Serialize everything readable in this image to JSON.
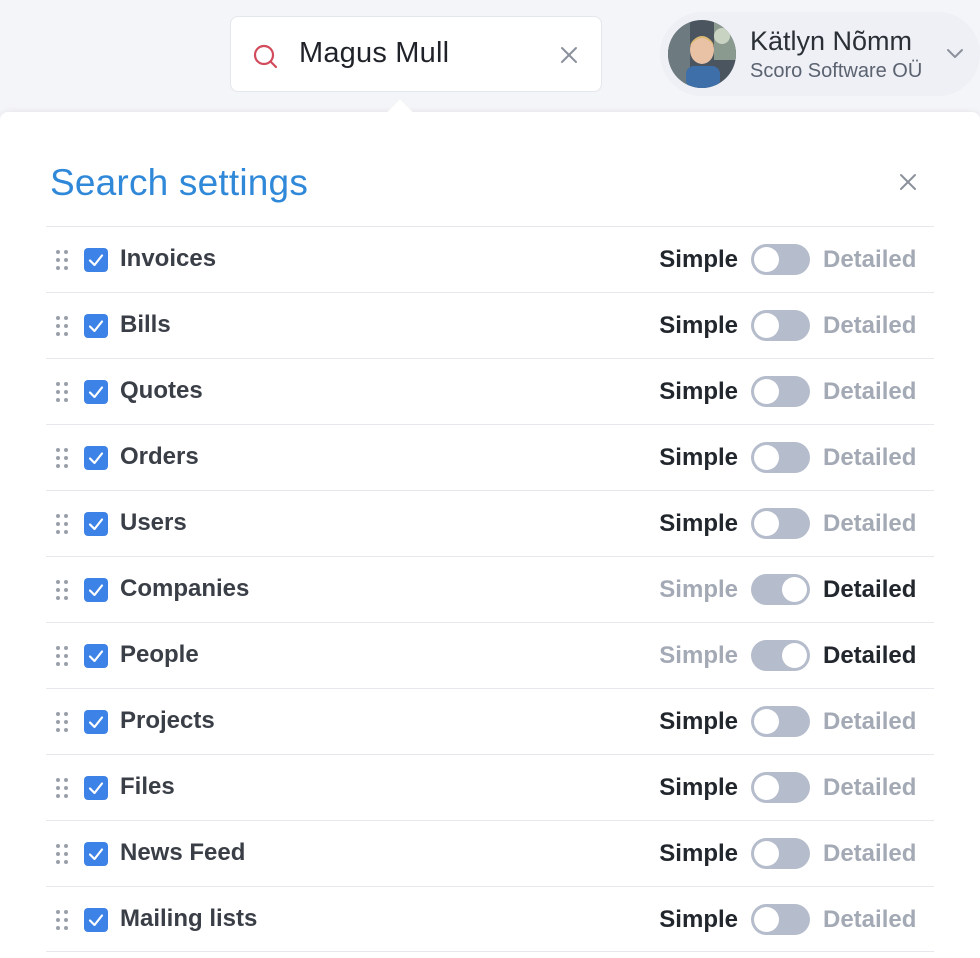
{
  "search": {
    "value": "Magus Mull"
  },
  "user": {
    "name": "Kätlyn Nõmm",
    "company": "Scoro Software OÜ"
  },
  "panel": {
    "title": "Search settings"
  },
  "options": {
    "simple": "Simple",
    "detailed": "Detailed"
  },
  "colors": {
    "accent": "#2f88d8",
    "checkbox": "#3d82e6",
    "toggle": "#b5bccb",
    "search_icon": "#d14b5c"
  },
  "items": [
    {
      "label": "Invoices",
      "checked": true,
      "mode": "simple"
    },
    {
      "label": "Bills",
      "checked": true,
      "mode": "simple"
    },
    {
      "label": "Quotes",
      "checked": true,
      "mode": "simple"
    },
    {
      "label": "Orders",
      "checked": true,
      "mode": "simple"
    },
    {
      "label": "Users",
      "checked": true,
      "mode": "simple"
    },
    {
      "label": "Companies",
      "checked": true,
      "mode": "detailed"
    },
    {
      "label": "People",
      "checked": true,
      "mode": "detailed"
    },
    {
      "label": "Projects",
      "checked": true,
      "mode": "simple"
    },
    {
      "label": "Files",
      "checked": true,
      "mode": "simple"
    },
    {
      "label": "News Feed",
      "checked": true,
      "mode": "simple"
    },
    {
      "label": "Mailing lists",
      "checked": true,
      "mode": "simple"
    }
  ]
}
